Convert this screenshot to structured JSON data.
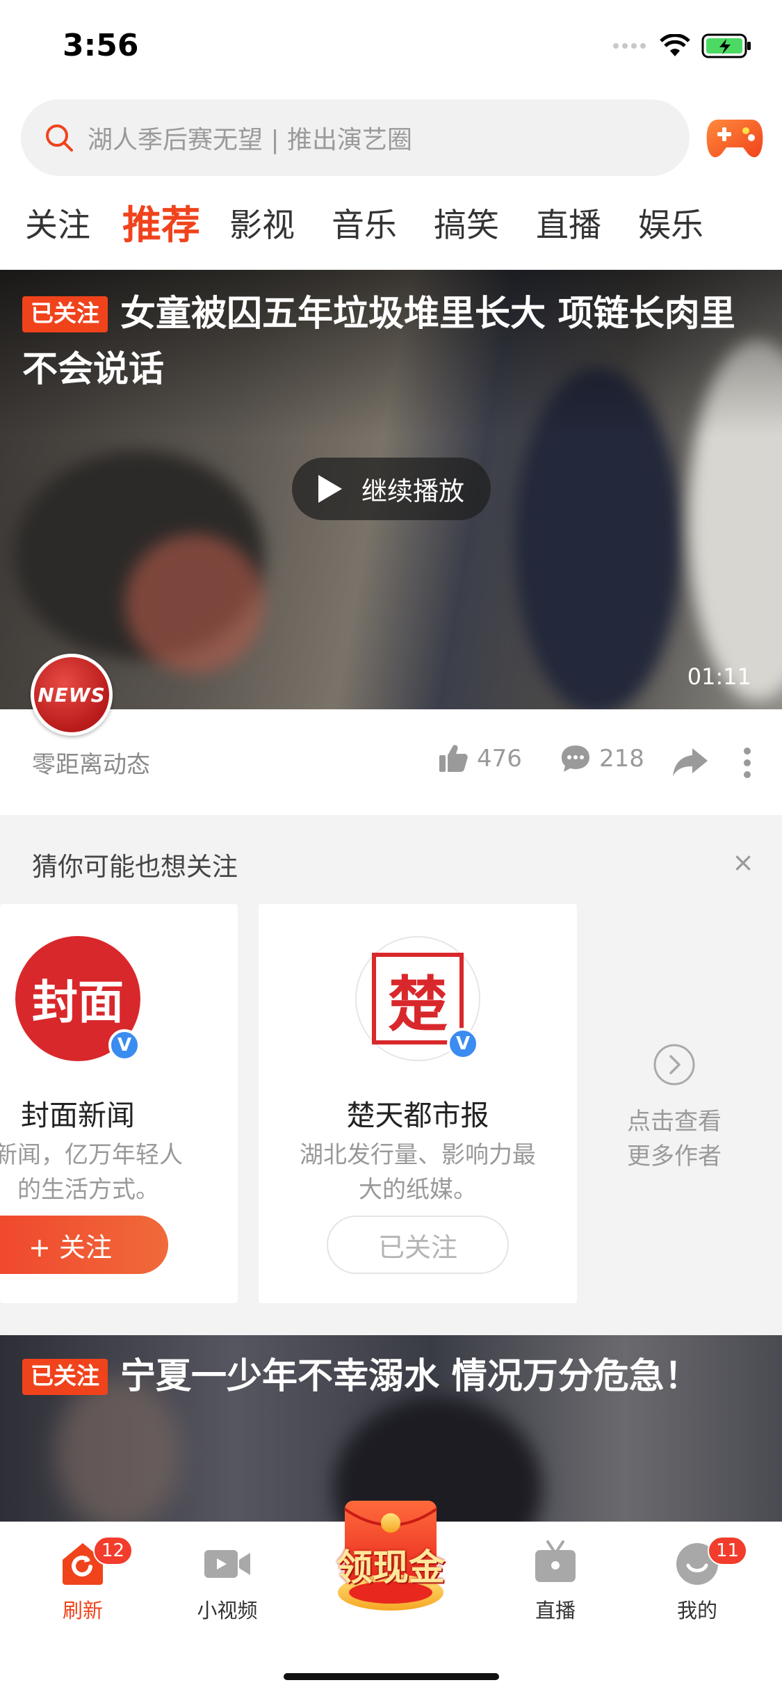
{
  "status_bar": {
    "time": "3:56"
  },
  "search": {
    "placeholder": "湖人季后赛无望 | 推出演艺圈"
  },
  "tabs": [
    {
      "label": "关注"
    },
    {
      "label": "推荐",
      "active": true
    },
    {
      "label": "影视"
    },
    {
      "label": "音乐"
    },
    {
      "label": "搞笑"
    },
    {
      "label": "直播"
    },
    {
      "label": "娱乐"
    }
  ],
  "feed": {
    "video1": {
      "badge": "已关注",
      "title": "女童被囚五年垃圾堆里长大 项链长肉里不会说话",
      "play_label": "继续播放",
      "duration": "01:11",
      "logo_text": "NEWS",
      "source": "零距离动态",
      "likes": "476",
      "comments": "218"
    },
    "video2": {
      "badge": "已关注",
      "title": "宁夏一少年不幸溺水 情况万分危急！"
    }
  },
  "recommend": {
    "title": "猜你可能也想关注",
    "close": "×",
    "cards": [
      {
        "avatar_text": "封面",
        "name": "封面新闻",
        "desc_line1": "新闻，亿万年轻人",
        "desc_line2": "的生活方式。",
        "button": "+ 关注",
        "followed": false
      },
      {
        "avatar_text": "楚",
        "name": "楚天都市报",
        "desc_line1": "湖北发行量、影响力最",
        "desc_line2": "大的纸媒。",
        "button": "已关注",
        "followed": true
      }
    ],
    "more_line1": "点击查看",
    "more_line2": "更多作者"
  },
  "bottom_nav": {
    "items": [
      {
        "label": "刷新",
        "badge": "12",
        "icon": "refresh-home-icon",
        "active": true
      },
      {
        "label": "小视频",
        "icon": "video-camera-icon"
      },
      {
        "label": "直播",
        "icon": "tv-icon"
      },
      {
        "label": "我的",
        "badge": "11",
        "icon": "profile-icon"
      }
    ],
    "cash_label": "领现金"
  },
  "colors": {
    "accent": "#f0431c",
    "verified": "#3a8cf0",
    "muted_text": "#9a9a9a"
  }
}
